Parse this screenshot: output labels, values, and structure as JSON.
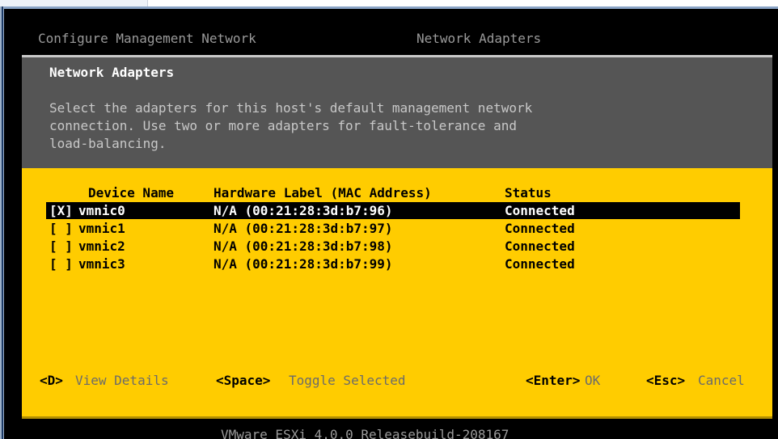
{
  "console": {
    "header_left": "Configure Management Network",
    "header_right": "Network Adapters",
    "footer": "VMware ESXi 4.0.0 Releasebuild-208167"
  },
  "dialog": {
    "title": "Network Adapters",
    "description": [
      "Select the adapters for this host's default management network",
      "connection. Use two or more adapters for fault-tolerance and",
      "load-balancing."
    ],
    "columns": {
      "device": "Device Name",
      "hardware": "Hardware Label (MAC Address)",
      "status": "Status"
    },
    "rows": [
      {
        "check": "[X]",
        "device": "vmnic0",
        "hardware": "N/A (00:21:28:3d:b7:96)",
        "status": "Connected",
        "selected": true
      },
      {
        "check": "[ ]",
        "device": "vmnic1",
        "hardware": "N/A (00:21:28:3d:b7:97)",
        "status": "Connected",
        "selected": false
      },
      {
        "check": "[ ]",
        "device": "vmnic2",
        "hardware": "N/A (00:21:28:3d:b7:98)",
        "status": "Connected",
        "selected": false
      },
      {
        "check": "[ ]",
        "device": "vmnic3",
        "hardware": "N/A (00:21:28:3d:b7:99)",
        "status": "Connected",
        "selected": false
      }
    ],
    "footer": {
      "details_key": "<D>",
      "details_label": "View Details",
      "toggle_key": "<Space>",
      "toggle_label": "Toggle Selected",
      "ok_key": "<Enter>",
      "ok_label": "OK",
      "cancel_key": "<Esc>",
      "cancel_label": "Cancel"
    }
  },
  "colors": {
    "console_bg": "#000000",
    "dialog_header_bg": "#555555",
    "dialog_body_bg": "#ffcc00",
    "selected_row_bg": "#000000"
  }
}
